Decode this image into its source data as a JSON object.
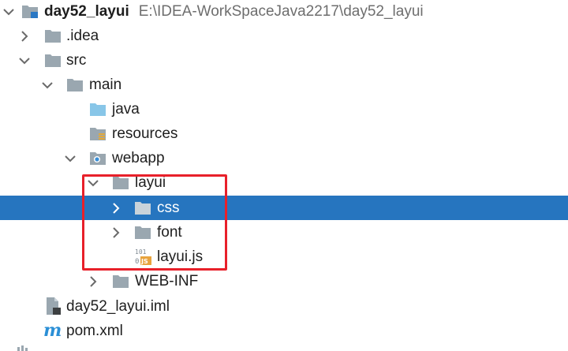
{
  "tree": {
    "project": {
      "name": "day52_layui",
      "path": "E:\\IDEA-WorkSpaceJava2217\\day52_layui"
    },
    "idea": {
      "label": ".idea"
    },
    "src": {
      "label": "src"
    },
    "main": {
      "label": "main"
    },
    "java": {
      "label": "java"
    },
    "resources": {
      "label": "resources"
    },
    "webapp": {
      "label": "webapp"
    },
    "layui": {
      "label": "layui"
    },
    "css": {
      "label": "css"
    },
    "font": {
      "label": "font"
    },
    "layuijs": {
      "label": "layui.js",
      "icon_text_top": "101",
      "icon_text_bottom": "JS"
    },
    "webinf": {
      "label": "WEB-INF"
    },
    "iml": {
      "label": "day52_layui.iml"
    },
    "pom": {
      "label": "pom.xml"
    }
  },
  "colors": {
    "selection": "#2675bf",
    "highlight_border": "#e8202a",
    "folder": "#9aa7b0",
    "source_folder": "#88c6e8",
    "maven_m": "#2b8fd6"
  },
  "icons": {
    "project": "module-folder-icon",
    "folder": "folder-icon",
    "source_root": "source-folder-icon",
    "resources_root": "resources-folder-icon",
    "web_root": "web-folder-icon",
    "js_file": "javascript-file-icon",
    "iml_file": "iml-file-icon",
    "maven": "maven-pom-icon"
  }
}
